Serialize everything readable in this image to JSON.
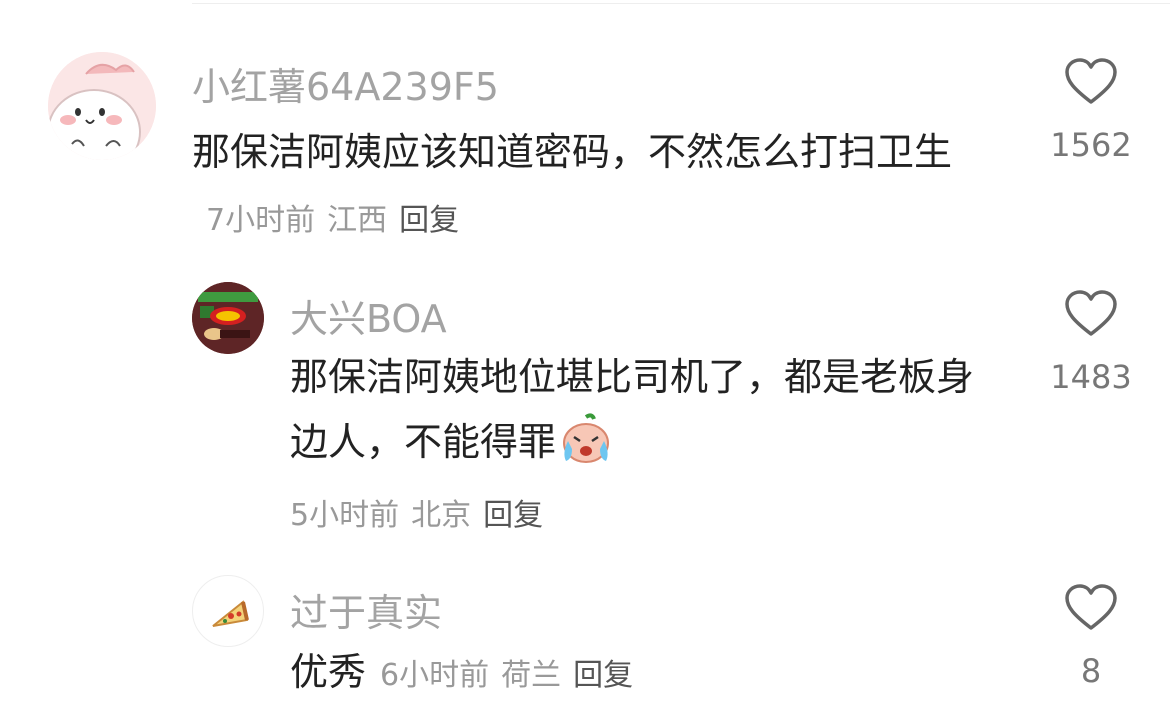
{
  "comments": [
    {
      "username": "小红薯64A239F5",
      "text": "那保洁阿姨应该知道密码，不然怎么打扫卫生",
      "time": "7小时前",
      "location": "江西",
      "reply_label": "回复",
      "likes": "1562",
      "avatar_icon": "cartoon-face-avatar"
    },
    {
      "username": "大兴BOA",
      "text": "那保洁阿姨地位堪比司机了，都是老板身边人，不能得罪",
      "emoji": "crying-peach-emoji",
      "time": "5小时前",
      "location": "北京",
      "reply_label": "回复",
      "likes": "1483",
      "avatar_icon": "lays-chips-avatar"
    },
    {
      "username": "过于真实",
      "text": "优秀",
      "time": "6小时前",
      "location": "荷兰",
      "reply_label": "回复",
      "likes": "8",
      "avatar_icon": "pizza-slice-avatar"
    }
  ],
  "colors": {
    "username": "#a3a3a3",
    "content": "#222222",
    "meta": "#999999",
    "like_icon": "#666666"
  },
  "icons": {
    "like": "heart-outline-icon"
  }
}
